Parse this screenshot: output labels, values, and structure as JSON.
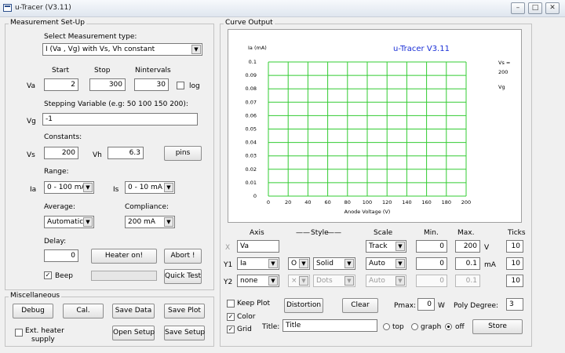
{
  "window": {
    "title": "u-Tracer (V3.11)",
    "controls": {
      "minimize": "–",
      "maximize": "□",
      "close": "✕"
    }
  },
  "setup": {
    "group_label": "Measurement Set-Up",
    "measurement_type_label": "Select Measurement type:",
    "measurement_type_value": "I (Va , Vg) with Vs, Vh constant",
    "start_label": "Start",
    "stop_label": "Stop",
    "nintervals_label": "Nintervals",
    "va_label": "Va",
    "va_start": "2",
    "va_stop": "300",
    "va_nintervals": "30",
    "log_label": "log",
    "stepping_label": "Stepping Variable (e.g: 50 100 150 200):",
    "vg_label": "Vg",
    "vg_value": "-1",
    "constants_label": "Constants:",
    "vs_label": "Vs",
    "vs_value": "200",
    "vh_label": "Vh",
    "vh_value": "6.3",
    "pins_button": "pins",
    "range_label": "Range:",
    "ia_label": "Ia",
    "ia_range": "0 - 100 mA",
    "is_label": "Is",
    "is_range": "0 - 10 mA",
    "average_label": "Average:",
    "average_value": "Automatic",
    "compliance_label": "Compliance:",
    "compliance_value": "200 mA",
    "delay_label": "Delay:",
    "delay_value": "0",
    "heater_button": "Heater on!",
    "abort_button": "Abort !",
    "beep_label": "Beep",
    "beep_checked": "✓",
    "quick_test_button": "Quick Test",
    "progress_fraction": 0
  },
  "misc": {
    "group_label": "Miscellaneous",
    "debug_button": "Debug",
    "cal_button": "Cal.",
    "save_data_button": "Save Data",
    "save_plot_button": "Save Plot",
    "ext_heater_label_1": "Ext. heater",
    "ext_heater_label_2": "supply",
    "open_setup_button": "Open Setup",
    "save_setup_button": "Save Setup"
  },
  "curve": {
    "group_label": "Curve Output",
    "axis_header": "Axis",
    "style_header": "Style",
    "scale_header": "Scale",
    "min_header": "Min.",
    "max_header": "Max.",
    "ticks_header": "Ticks",
    "x_row": {
      "label": "X",
      "axis": "Va",
      "scale": "Track",
      "min": "0",
      "max": "200",
      "unit": "V",
      "ticks": "10"
    },
    "y1_row": {
      "label": "Y1",
      "axis": "Ia",
      "marker": "O",
      "style": "Solid",
      "scale": "Auto",
      "min": "0",
      "max": "0.1",
      "unit": "mA",
      "ticks": "10"
    },
    "y2_row": {
      "label": "Y2",
      "axis": "none",
      "marker": "×",
      "style": "Dots",
      "scale": "Auto",
      "min": "0",
      "max": "0.1",
      "ticks": "10"
    },
    "keep_plot_label": "Keep Plot",
    "distortion_button": "Distortion",
    "clear_button": "Clear",
    "pmax_label": "Pmax:",
    "pmax_value": "0",
    "pmax_unit": "W",
    "poly_degree_label": "Poly Degree:",
    "poly_degree_value": "3",
    "color_label": "Color",
    "color_checked": "✓",
    "grid_label": "Grid",
    "grid_checked": "✓",
    "title_label": "Title:",
    "title_value": "Title",
    "legend_top": "top",
    "legend_graph": "graph",
    "legend_off": "off",
    "store_button": "Store"
  },
  "chart_data": {
    "type": "line",
    "title": "u-Tracer V3.11",
    "xlabel": "Anode Voltage (V)",
    "ylabel": "Ia (mA)",
    "xlim": [
      0,
      200
    ],
    "ylim": [
      0,
      0.1
    ],
    "x_ticks": [
      "0",
      "20",
      "40",
      "60",
      "80",
      "100",
      "120",
      "140",
      "160",
      "180",
      "200"
    ],
    "y_ticks": [
      "0",
      "0.01",
      "0.02",
      "0.03",
      "0.04",
      "0.05",
      "0.06",
      "0.07",
      "0.08",
      "0.09",
      "0.1"
    ],
    "grid": true,
    "grid_color": "#33cc33",
    "series": [],
    "annotations": [
      "Vs =",
      "200",
      "Vg"
    ]
  }
}
